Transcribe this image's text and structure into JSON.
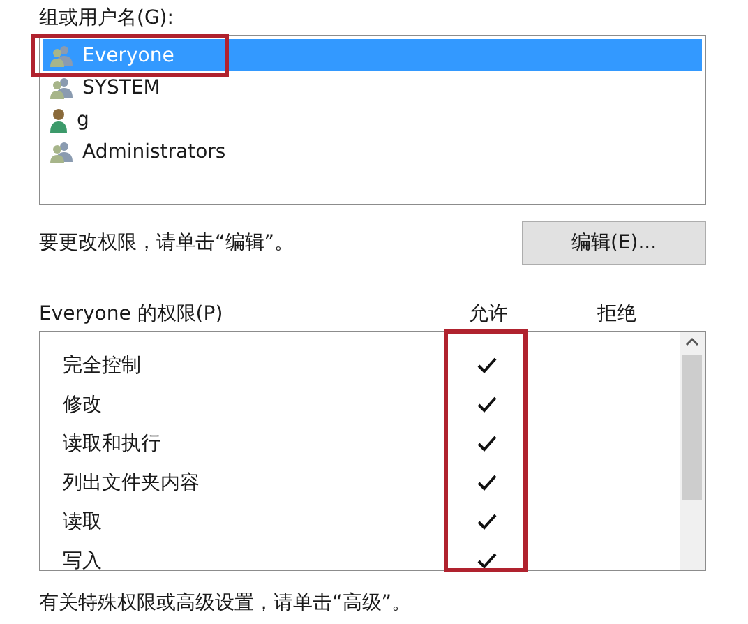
{
  "users_label": "组或用户名(G):",
  "users": [
    {
      "name": "Everyone",
      "kind": "group",
      "selected": true
    },
    {
      "name": "SYSTEM",
      "kind": "group",
      "selected": false
    },
    {
      "name": "g",
      "kind": "user",
      "selected": false
    },
    {
      "name": "Administrators",
      "kind": "group",
      "selected": false
    }
  ],
  "edit_hint": "要更改权限，请单击“编辑”。",
  "edit_button": "编辑(E)...",
  "permissions_label": "Everyone 的权限(P)",
  "columns": [
    "允许",
    "拒绝"
  ],
  "permissions": [
    {
      "name": "完全控制",
      "allow": true,
      "deny": false
    },
    {
      "name": "修改",
      "allow": true,
      "deny": false
    },
    {
      "name": "读取和执行",
      "allow": true,
      "deny": false
    },
    {
      "name": "列出文件夹内容",
      "allow": true,
      "deny": false
    },
    {
      "name": "读取",
      "allow": true,
      "deny": false
    },
    {
      "name": "写入",
      "allow": true,
      "deny": false
    }
  ],
  "advanced_hint": "有关特殊权限或高级设置，请单击“高级”。"
}
